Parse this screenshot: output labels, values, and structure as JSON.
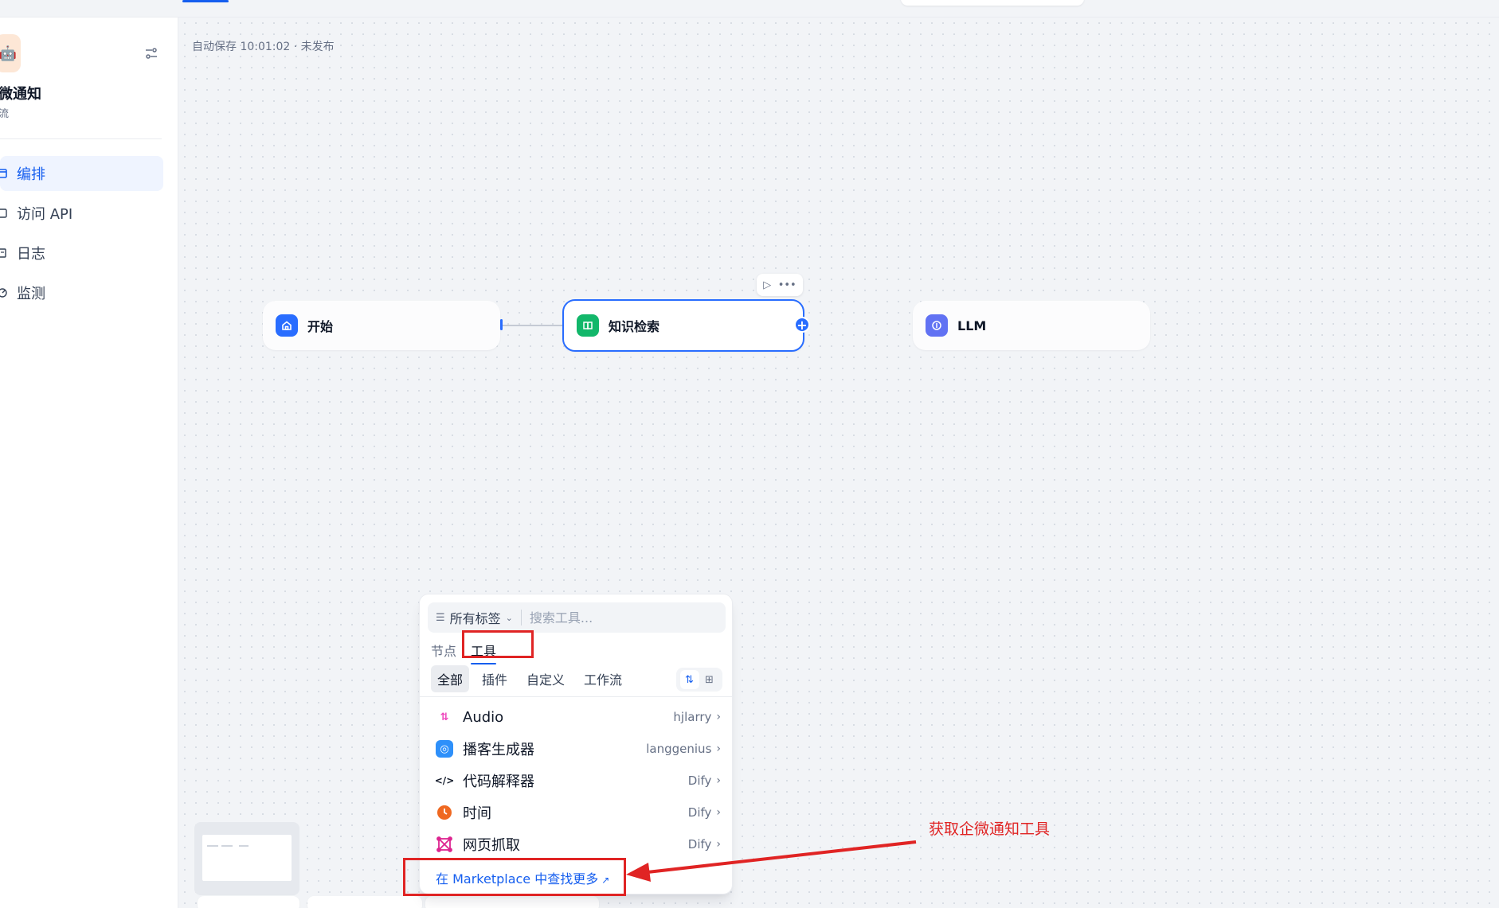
{
  "sidebar": {
    "app_icon": "robot-emoji",
    "app_name": "微通知",
    "app_type": "流",
    "nav": [
      {
        "label": "编排",
        "icon": "layout-icon",
        "active": true
      },
      {
        "label": "访问 API",
        "icon": "terminal-icon",
        "active": false
      },
      {
        "label": "日志",
        "icon": "file-list-icon",
        "active": false
      },
      {
        "label": "监测",
        "icon": "gauge-icon",
        "active": false
      }
    ]
  },
  "canvas": {
    "autosave_status": "自动保存 10:01:02 · 未发布",
    "nodes": [
      {
        "title": "开始",
        "icon": "home-icon",
        "color": "#296dff"
      },
      {
        "title": "知识检索",
        "icon": "book-icon",
        "color": "#12b76a"
      },
      {
        "title": "LLM",
        "icon": "brain-icon",
        "color": "#6172f3"
      }
    ]
  },
  "tool_picker": {
    "tag_filter_label": "所有标签",
    "search_placeholder": "搜索工具...",
    "tabs": [
      {
        "label": "节点",
        "active": false
      },
      {
        "label": "工具",
        "active": true
      }
    ],
    "categories": [
      {
        "label": "全部",
        "active": true
      },
      {
        "label": "插件",
        "active": false
      },
      {
        "label": "自定义",
        "active": false
      },
      {
        "label": "工作流",
        "active": false
      }
    ],
    "tools": [
      {
        "name": "Audio",
        "author": "hjlarry",
        "icon": "audio-icon",
        "color": "#ee46bc"
      },
      {
        "name": "播客生成器",
        "author": "langgenius",
        "icon": "podcast-icon",
        "color": "#2e90fa"
      },
      {
        "name": "代码解释器",
        "author": "Dify",
        "icon": "code-icon",
        "color": "#101828"
      },
      {
        "name": "时间",
        "author": "Dify",
        "icon": "clock-icon",
        "color": "#ef6820"
      },
      {
        "name": "网页抓取",
        "author": "Dify",
        "icon": "web-scraper-icon",
        "color": "#dd2590"
      }
    ],
    "marketplace_link": "在 Marketplace 中查找更多"
  },
  "annotation": {
    "text": "获取企微通知工具",
    "color": "#e02424"
  }
}
